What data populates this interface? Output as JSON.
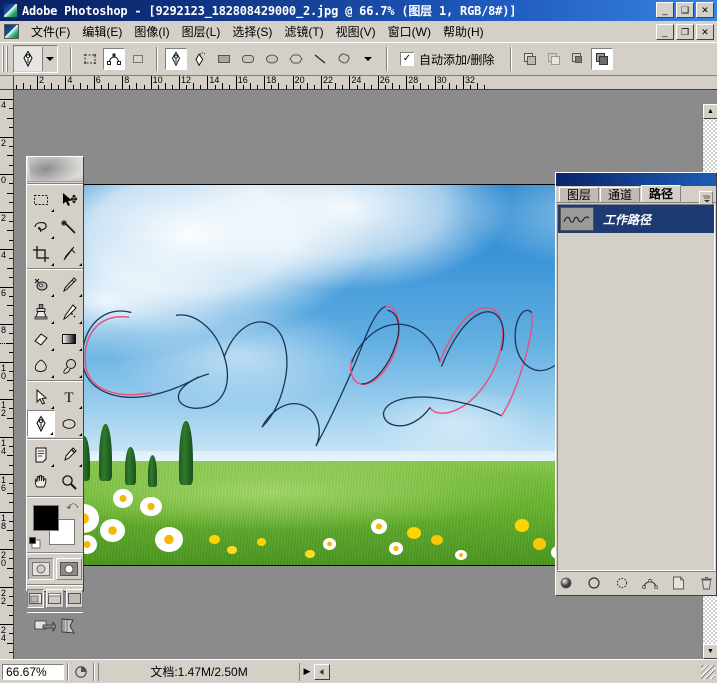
{
  "window": {
    "app_title": "Adobe Photoshop",
    "document_title": "[9292123_182808429000_2.jpg @ 66.7% (图层 1, RGB/8#)]",
    "full_title": "Adobe Photoshop - [9292123_182808429000_2.jpg @ 66.7%  (图层 1,  RGB/8#)]",
    "minimize": "_",
    "maximize": "❑",
    "close": "✕",
    "restore": "❐"
  },
  "menu": {
    "items": [
      {
        "label": "文件(F)",
        "name": "menu-file"
      },
      {
        "label": "编辑(E)",
        "name": "menu-edit"
      },
      {
        "label": "图像(I)",
        "name": "menu-image"
      },
      {
        "label": "图层(L)",
        "name": "menu-layer"
      },
      {
        "label": "选择(S)",
        "name": "menu-select"
      },
      {
        "label": "滤镜(T)",
        "name": "menu-filter"
      },
      {
        "label": "视图(V)",
        "name": "menu-view"
      },
      {
        "label": "窗口(W)",
        "name": "menu-window"
      },
      {
        "label": "帮助(H)",
        "name": "menu-help"
      }
    ]
  },
  "options_bar": {
    "tool_preset_icon": "pen-tool-icon",
    "mode_buttons": [
      {
        "name": "shape-layers-button",
        "icon": "shape-layer-icon",
        "selected": false
      },
      {
        "name": "paths-button",
        "icon": "paths-icon",
        "selected": true
      },
      {
        "name": "fill-pixels-button",
        "icon": "fill-pixels-icon",
        "selected": false
      }
    ],
    "shape_tools": [
      {
        "name": "pen-tool-button",
        "icon": "pen-icon",
        "selected": true
      },
      {
        "name": "freeform-pen-tool-button",
        "icon": "freeform-pen-icon",
        "selected": false
      },
      {
        "name": "rectangle-tool-button",
        "icon": "rectangle-icon",
        "selected": false
      },
      {
        "name": "rounded-rectangle-tool-button",
        "icon": "rounded-rectangle-icon",
        "selected": false
      },
      {
        "name": "ellipse-tool-button",
        "icon": "ellipse-icon",
        "selected": false
      },
      {
        "name": "polygon-tool-button",
        "icon": "polygon-icon",
        "selected": false
      },
      {
        "name": "line-tool-button",
        "icon": "line-icon",
        "selected": false
      },
      {
        "name": "custom-shape-tool-button",
        "icon": "custom-shape-icon",
        "selected": false
      }
    ],
    "auto_add_delete": {
      "label": "自动添加/删除",
      "checked": true,
      "check_glyph": "✓"
    },
    "path_ops": [
      {
        "name": "add-to-path-area-button",
        "selected": false
      },
      {
        "name": "subtract-from-path-area-button",
        "selected": false
      },
      {
        "name": "intersect-path-areas-button",
        "selected": false
      },
      {
        "name": "exclude-overlapping-path-areas-button",
        "selected": true
      }
    ]
  },
  "toolbox": {
    "tools": [
      {
        "name": "rectangular-marquee-tool",
        "icon": "marquee-icon",
        "selected": false,
        "hasFlyout": true
      },
      {
        "name": "move-tool",
        "icon": "move-icon",
        "selected": false,
        "hasFlyout": false
      },
      {
        "name": "lasso-tool",
        "icon": "lasso-icon",
        "selected": false,
        "hasFlyout": true
      },
      {
        "name": "magic-wand-tool",
        "icon": "magic-wand-icon",
        "selected": false,
        "hasFlyout": false
      },
      {
        "name": "crop-tool",
        "icon": "crop-icon",
        "selected": false,
        "hasFlyout": false
      },
      {
        "name": "slice-tool",
        "icon": "slice-icon",
        "selected": false,
        "hasFlyout": true
      },
      {
        "name": "healing-brush-tool",
        "icon": "healing-brush-icon",
        "selected": false,
        "hasFlyout": true
      },
      {
        "name": "brush-tool",
        "icon": "brush-icon",
        "selected": false,
        "hasFlyout": true
      },
      {
        "name": "clone-stamp-tool",
        "icon": "clone-stamp-icon",
        "selected": false,
        "hasFlyout": true
      },
      {
        "name": "history-brush-tool",
        "icon": "history-brush-icon",
        "selected": false,
        "hasFlyout": true
      },
      {
        "name": "eraser-tool",
        "icon": "eraser-icon",
        "selected": false,
        "hasFlyout": true
      },
      {
        "name": "gradient-tool",
        "icon": "gradient-icon",
        "selected": false,
        "hasFlyout": true
      },
      {
        "name": "blur-tool",
        "icon": "blur-icon",
        "selected": false,
        "hasFlyout": true
      },
      {
        "name": "dodge-tool",
        "icon": "dodge-icon",
        "selected": false,
        "hasFlyout": true
      },
      {
        "name": "path-selection-tool",
        "icon": "path-selection-arrow-icon",
        "selected": false,
        "hasFlyout": true
      },
      {
        "name": "type-tool",
        "icon": "type-icon",
        "selected": false,
        "hasFlyout": true
      },
      {
        "name": "pen-tool",
        "icon": "pen-icon",
        "selected": true,
        "hasFlyout": true
      },
      {
        "name": "ellipse-shape-tool",
        "icon": "ellipse-icon",
        "selected": false,
        "hasFlyout": true
      },
      {
        "name": "notes-tool",
        "icon": "notes-icon",
        "selected": false,
        "hasFlyout": true
      },
      {
        "name": "eyedropper-tool",
        "icon": "eyedropper-icon",
        "selected": false,
        "hasFlyout": true
      },
      {
        "name": "hand-tool",
        "icon": "hand-icon",
        "selected": false,
        "hasFlyout": false
      },
      {
        "name": "zoom-tool",
        "icon": "zoom-magnifier-icon",
        "selected": false,
        "hasFlyout": false
      }
    ],
    "colors": {
      "foreground": "#000000",
      "background": "#ffffff",
      "swap_glyph": "⤮",
      "swap_name": "swap-colors-icon",
      "default_name": "default-colors-icon"
    },
    "quick_mask": [
      {
        "name": "standard-mode-button",
        "selected": true
      },
      {
        "name": "quick-mask-mode-button",
        "selected": false
      }
    ],
    "screen_modes": [
      {
        "name": "standard-screen-mode-button",
        "selected": true
      },
      {
        "name": "full-screen-with-menubar-button",
        "selected": false
      },
      {
        "name": "full-screen-mode-button",
        "selected": false
      }
    ],
    "jump_to": [
      {
        "name": "jump-to-imageready-button",
        "icon": "imageready-icon"
      },
      {
        "name": "toolbox-extra-button",
        "icon": "flag-icon"
      }
    ]
  },
  "rulers": {
    "unit": "cm",
    "horizontal_labels": [
      "2",
      "4",
      "6",
      "8",
      "10",
      "12",
      "14",
      "16",
      "18",
      "20",
      "22",
      "24",
      "26",
      "28",
      "30",
      "32"
    ],
    "vertical_labels": [
      "4",
      "2",
      "0",
      "2",
      "4",
      "6",
      "8",
      "10",
      "12",
      "14",
      "16",
      "18",
      "20",
      "22",
      "24"
    ]
  },
  "palette": {
    "tabs": [
      {
        "label": "图层",
        "name": "tab-layers",
        "active": false
      },
      {
        "label": "通道",
        "name": "tab-channels",
        "active": false
      },
      {
        "label": "路径",
        "name": "tab-paths",
        "active": true
      }
    ],
    "paths": [
      {
        "name": "工作路径",
        "selected": true,
        "thumb_name": "work-path-thumbnail"
      }
    ],
    "footer_buttons": [
      {
        "name": "fill-path-with-foreground-button",
        "icon": "filled-circle-icon"
      },
      {
        "name": "stroke-path-with-brush-button",
        "icon": "circle-outline-icon"
      },
      {
        "name": "load-path-as-selection-button",
        "icon": "dashed-circle-icon"
      },
      {
        "name": "make-work-path-from-selection-button",
        "icon": "path-anchor-icon"
      },
      {
        "name": "create-new-path-button",
        "icon": "new-page-icon"
      },
      {
        "name": "delete-current-path-button",
        "icon": "trash-icon"
      }
    ],
    "menu_button": {
      "name": "palette-menu-button",
      "glyph": "▸"
    }
  },
  "canvas": {
    "zoom_label": "66.7%",
    "layer_label": "图层 1",
    "color_mode": "RGB/8#",
    "image_description": "sky-with-clouds-and-green-meadow-with-daisies",
    "path_stroke_color": "#1c3455",
    "path_highlight_color": "#e8537d",
    "sky_color": "#3a8fd0",
    "grass_color": "#69b42f"
  },
  "statusbar": {
    "zoom_value": "66.67%",
    "preview_icon": "preview-icon",
    "doc_info": "文档:1.47M/2.50M",
    "expand_glyph": "▶",
    "resize_glyph": "◣"
  }
}
